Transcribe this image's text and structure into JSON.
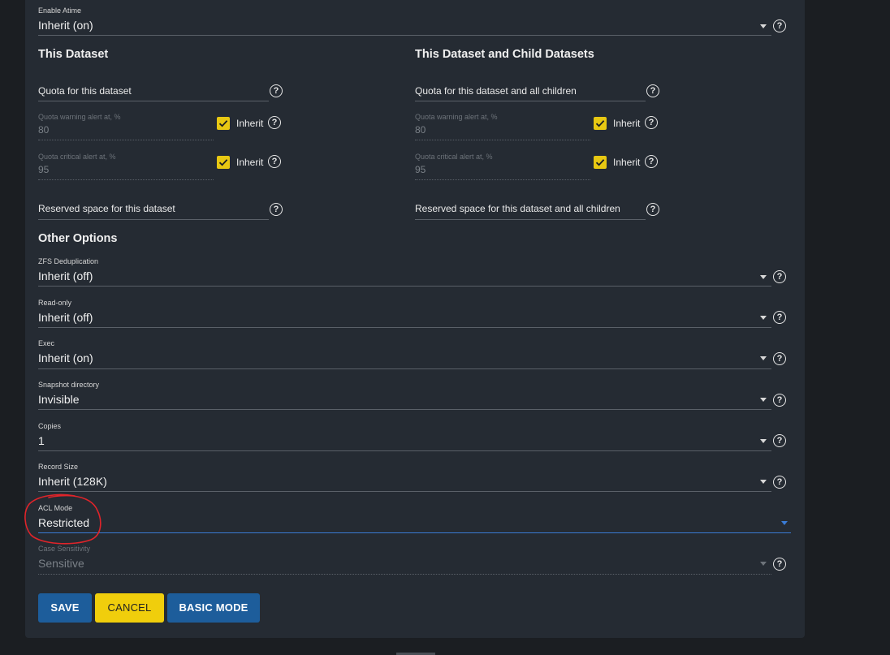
{
  "atime": {
    "label": "Enable Atime",
    "value": "Inherit (on)"
  },
  "this_dataset": {
    "title": "This Dataset",
    "quota_label": "Quota for this dataset",
    "warn_label": "Quota warning alert at, %",
    "warn_value": "80",
    "crit_label": "Quota critical alert at, %",
    "crit_value": "95",
    "inherit_label": "Inherit",
    "reserved_label": "Reserved space for this dataset"
  },
  "child_datasets": {
    "title": "This Dataset and Child Datasets",
    "quota_label": "Quota for this dataset and all children",
    "warn_label": "Quota warning alert at, %",
    "warn_value": "80",
    "crit_label": "Quota critical alert at, %",
    "crit_value": "95",
    "inherit_label": "Inherit",
    "reserved_label": "Reserved space for this dataset and all children"
  },
  "other": {
    "title": "Other Options",
    "dedup": {
      "label": "ZFS Deduplication",
      "value": "Inherit (off)"
    },
    "readonly": {
      "label": "Read-only",
      "value": "Inherit (off)"
    },
    "exec": {
      "label": "Exec",
      "value": "Inherit (on)"
    },
    "snapdir": {
      "label": "Snapshot directory",
      "value": "Invisible"
    },
    "copies": {
      "label": "Copies",
      "value": "1"
    },
    "recordsize": {
      "label": "Record Size",
      "value": "Inherit (128K)"
    },
    "aclmode": {
      "label": "ACL Mode",
      "value": "Restricted"
    },
    "casesens": {
      "label": "Case Sensitivity",
      "value": "Sensitive"
    }
  },
  "buttons": {
    "save": "SAVE",
    "cancel": "CANCEL",
    "basic": "BASIC MODE"
  },
  "icons": {
    "help": "help-circle-icon",
    "dropdown": "chevron-down-icon",
    "check": "check-icon"
  },
  "colors": {
    "background": "#1b1e22",
    "card": "#252b33",
    "primary": "#1d5d9b",
    "accent": "#f0ce0c",
    "annotation": "#e0242a"
  }
}
